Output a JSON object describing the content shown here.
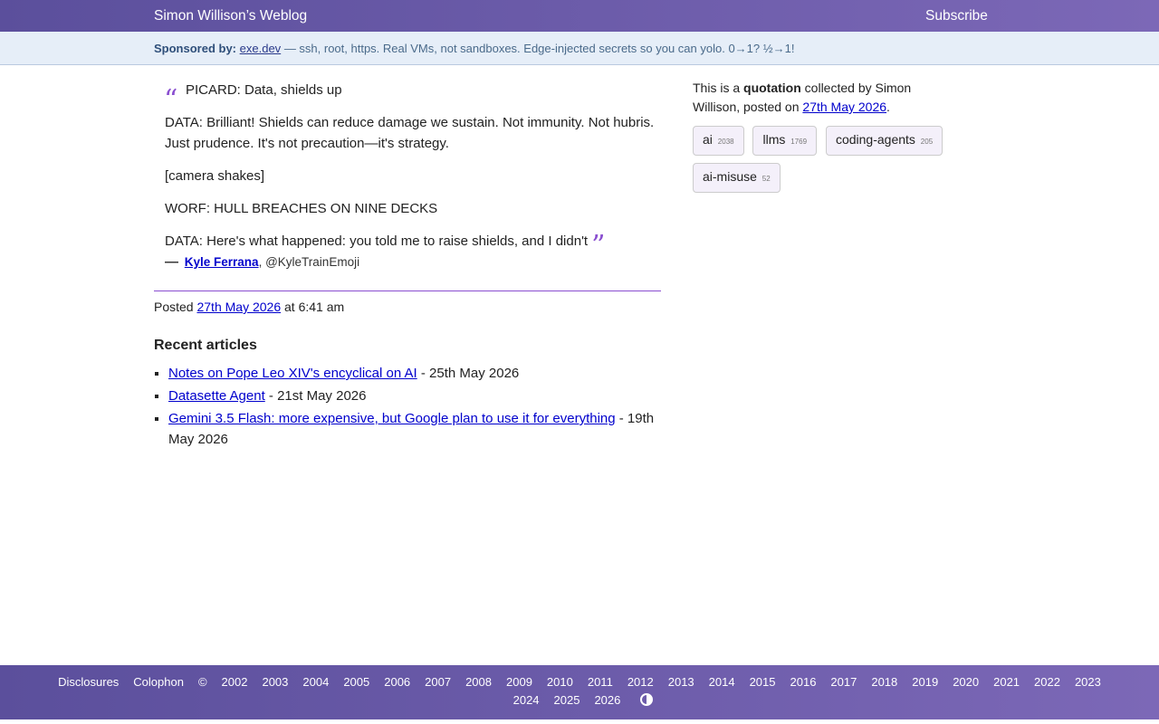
{
  "header": {
    "site_title": "Simon Willison’s Weblog",
    "subscribe": "Subscribe"
  },
  "sponsor": {
    "label": "Sponsored by:",
    "link": "exe.dev",
    "text": "— ssh, root, https. Real VMs, not sandboxes. Edge-injected secrets so you can yolo. 0→1? ½→1!"
  },
  "quote": {
    "lines": [
      "PICARD: Data, shields up",
      "DATA: Brilliant! Shields can reduce damage we sustain. Not immunity. Not hubris. Just prudence. It's not precaution—it's strategy.",
      "[camera shakes]",
      "WORF: HULL BREACHES ON NINE DECKS",
      "DATA: Here's what happened: you told me to raise shields, and I didn't"
    ],
    "open_mark": "“",
    "close_mark": "”",
    "dash": "—",
    "author": "Kyle Ferrana",
    "comma": ",",
    "handle": "@KyleTrainEmoji"
  },
  "posted": {
    "prefix": "Posted",
    "date": "27th May 2026",
    "time": "at 6:41 am"
  },
  "recent": {
    "heading": "Recent articles",
    "items": [
      {
        "title": "Notes on Pope Leo XIV's encyclical on AI",
        "date": " - 25th May 2026"
      },
      {
        "title": "Datasette Agent",
        "date": " - 21st May 2026"
      },
      {
        "title": "Gemini 3.5 Flash: more expensive, but Google plan to use it for everything",
        "date": " - 19th May 2026"
      }
    ]
  },
  "sidebar": {
    "intro_a": "This is a ",
    "intro_bold": "quotation",
    "intro_b": " collected by Simon Willison, posted on ",
    "date": "27th May 2026",
    "period": ".",
    "tags": [
      {
        "name": "ai",
        "count": "2038"
      },
      {
        "name": "llms",
        "count": "1769"
      },
      {
        "name": "coding-agents",
        "count": "205"
      },
      {
        "name": "ai-misuse",
        "count": "52"
      }
    ]
  },
  "footer": {
    "links": [
      "Disclosures",
      "Colophon",
      "©",
      "2002",
      "2003",
      "2004",
      "2005",
      "2006",
      "2007",
      "2008",
      "2009",
      "2010",
      "2011",
      "2012",
      "2013",
      "2014",
      "2015",
      "2016",
      "2017",
      "2018",
      "2019",
      "2020",
      "2021",
      "2022",
      "2023",
      "2024",
      "2025",
      "2026"
    ],
    "contrast_icon": "contrast-icon"
  }
}
